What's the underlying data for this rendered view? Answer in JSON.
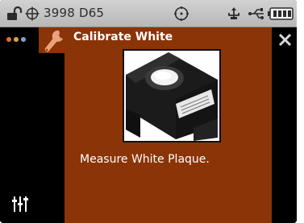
{
  "status_bar": {
    "reference_label": "3998 D65",
    "icons": [
      "lock-icon",
      "target-icon",
      "gauge-icon",
      "usb-icon",
      "usb-cable-icon",
      "battery-icon"
    ]
  },
  "sidebar": {
    "icons": [
      "dots-menu-icon",
      "sliders-icon"
    ],
    "dot_colors": [
      "#e86a3a",
      "#d8a64a",
      "#8aa0c8"
    ]
  },
  "screen": {
    "title": "Calibrate White",
    "message": "Measure White Plaque.",
    "icons": [
      "wrench-icon",
      "close-icon"
    ],
    "panel_color": "#8a3407"
  }
}
